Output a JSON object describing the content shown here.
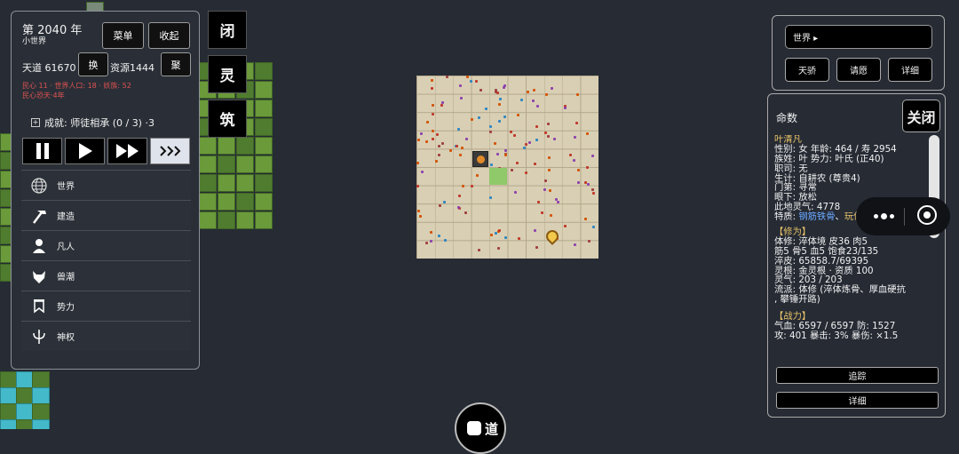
{
  "left_panel": {
    "year": "第 2040 年",
    "world_name": "小世界",
    "menu_button": "菜单",
    "collapse_button": "收起",
    "tiandao_label": "天道 61670",
    "swap_button": "换",
    "resource_label": "资源1444",
    "gather_button": "聚",
    "status_line1": "民心 11 · 世界人口: 18 · 妖族: 52",
    "status_line2": "民心恐天·4年",
    "achievement": "成就: 师徒相承 (0 / 3) ·3",
    "menu": [
      {
        "label": "世界",
        "icon": "globe-icon"
      },
      {
        "label": "建造",
        "icon": "hammer-icon"
      },
      {
        "label": "凡人",
        "icon": "person-icon"
      },
      {
        "label": "兽潮",
        "icon": "wolf-icon"
      },
      {
        "label": "势力",
        "icon": "banner-icon"
      },
      {
        "label": "神权",
        "icon": "trident-icon"
      }
    ]
  },
  "side_buttons": [
    "闭",
    "灵",
    "筑"
  ],
  "right_top": {
    "search_value": "世界 ▸",
    "buttons": [
      "天骄",
      "请愿",
      "详细"
    ]
  },
  "right_panel": {
    "title": "命数",
    "close_button": "关闭",
    "name": "叶清凡",
    "lines1": [
      "性别: 女  年龄: 464 / 寿 2954",
      "族姓: 叶  势力: 叶氏 (正40)",
      "职司: 无",
      "生计: 自耕农 (尊贵4)",
      "门第: 寻常",
      "眼下: 放松",
      "此地灵气: 4778"
    ],
    "traits_label": "特质: ",
    "trait_blue": "钢筋铁骨",
    "trait_sep": "、",
    "trait_yellow": "玩伴",
    "section_cultivation": "【修为】",
    "lines2": [
      "体修: 淬体境  皮36  肉5",
      "筋5  骨5  血5  饱食23/135",
      "淬皮: 65858.7/69395",
      "灵根: 金灵根 · 资质 100",
      "灵气: 203 / 203",
      "流派: 体修 (淬体炼骨、厚血硬抗",
      ", 攀锤开路)"
    ],
    "section_combat": "【战力】",
    "lines3": [
      "气血: 6597 / 6597  防: 1527",
      "攻: 401  暴击: 3%  暴伤: ×1.5"
    ],
    "track_button": "追踪",
    "detail_button": "详细"
  },
  "bottom_button_label": "道"
}
